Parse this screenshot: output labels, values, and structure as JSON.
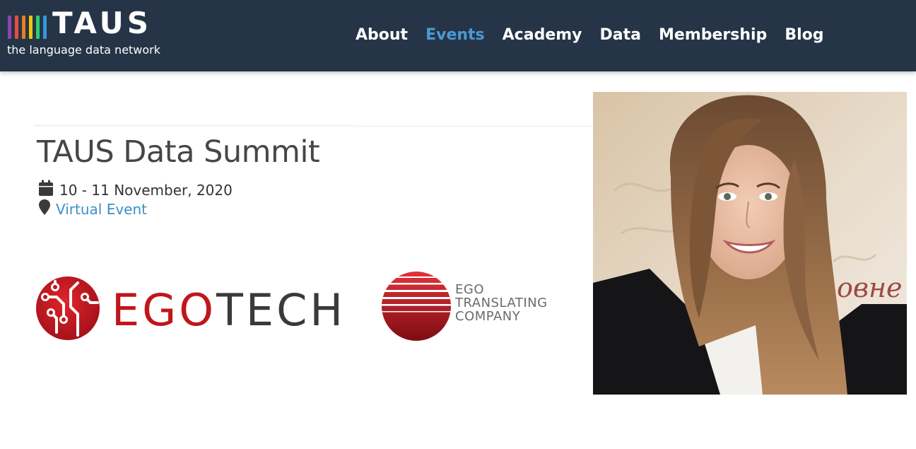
{
  "header": {
    "logo": {
      "word": "TAUS",
      "tagline": "the language data network",
      "bar_colors": [
        "#8e44ad",
        "#e74c3c",
        "#e67e22",
        "#f1c40f",
        "#2ecc71",
        "#3498db"
      ]
    },
    "nav": [
      {
        "label": "About",
        "active": false
      },
      {
        "label": "Events",
        "active": true
      },
      {
        "label": "Academy",
        "active": false
      },
      {
        "label": "Data",
        "active": false
      },
      {
        "label": "Membership",
        "active": false
      },
      {
        "label": "Blog",
        "active": false
      }
    ],
    "background": "#253447",
    "active_color": "#4a9ad4"
  },
  "event": {
    "title": "TAUS Data Summit",
    "date": "10 - 11 November, 2020",
    "location": "Virtual Event",
    "date_icon": "calendar-icon",
    "location_icon": "map-pin-icon"
  },
  "sponsors": {
    "egotech": {
      "part1": "EGO",
      "part2": "TECH"
    },
    "ego_translating": {
      "line1": "EGO",
      "line2": "TRANSLATING",
      "line3": "COMPANY"
    }
  },
  "speaker_photo": {
    "alt": "speaker-photo"
  }
}
